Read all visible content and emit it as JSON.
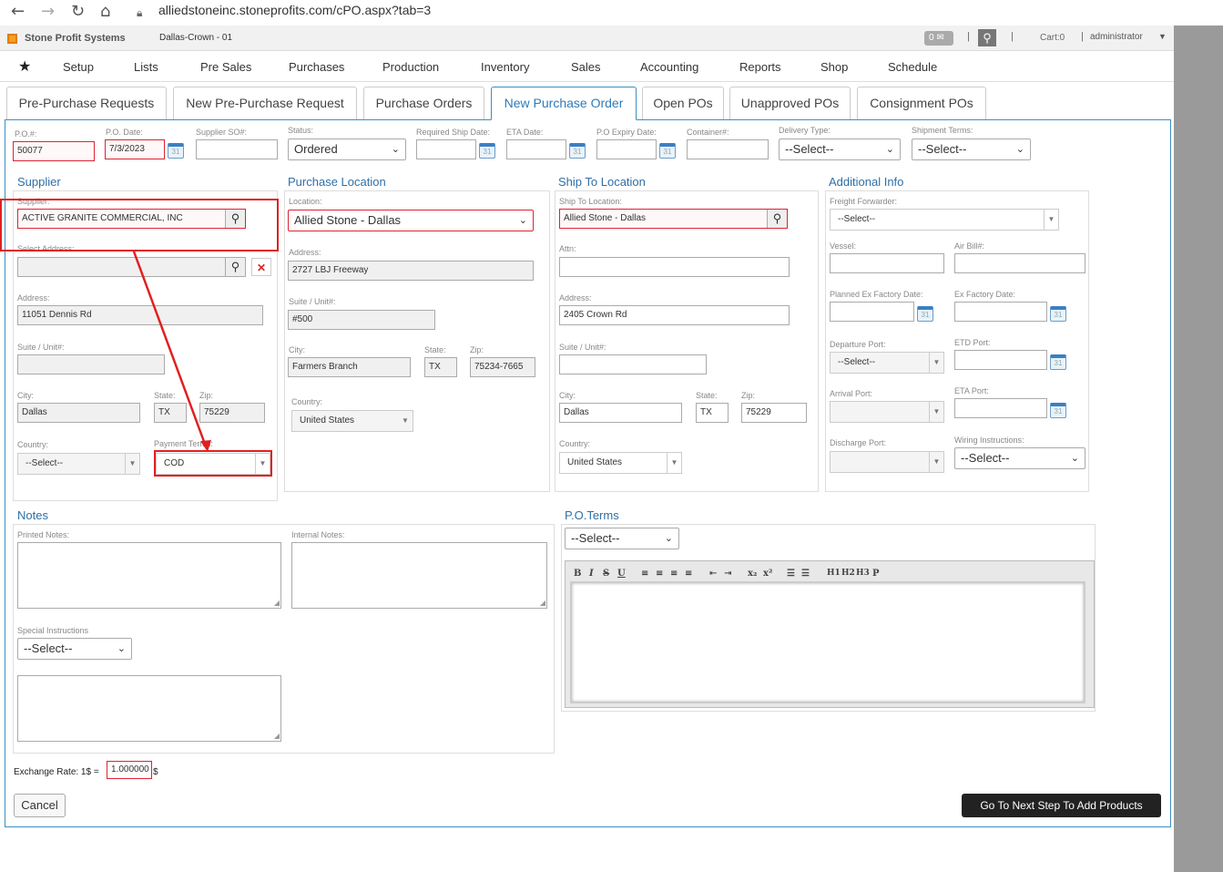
{
  "browser": {
    "url": "alliedstoneinc.stoneprofits.com/cPO.aspx?tab=3",
    "icons": [
      "back-icon",
      "forward-icon",
      "reload-icon",
      "home-icon",
      "lock-icon"
    ]
  },
  "appbar": {
    "brand": "Stone Profit Systems",
    "location": "Dallas-Crown - 01",
    "mail_count": "0",
    "cart": "Cart:0",
    "user": "administrator",
    "sep": "|"
  },
  "menu": {
    "star": "★",
    "items": [
      "Setup",
      "Lists",
      "Pre Sales",
      "Purchases",
      "Production",
      "Inventory",
      "Sales",
      "Accounting",
      "Reports",
      "Shop",
      "Schedule"
    ]
  },
  "tabs": [
    "Pre-Purchase Requests",
    "New Pre-Purchase Request",
    "Purchase Orders",
    "New Purchase Order",
    "Open POs",
    "Unapproved POs",
    "Consignment POs"
  ],
  "header": {
    "po_label": "P.O.#:",
    "po_value": "50077",
    "po_date_label": "P.O. Date:",
    "po_date_value": "7/3/2023",
    "supplier_so_label": "Supplier SO#:",
    "supplier_so_value": "",
    "status_label": "Status:",
    "status_value": "Ordered",
    "req_ship_label": "Required Ship Date:",
    "eta_label": "ETA Date:",
    "expiry_label": "P.O Expiry Date:",
    "container_label": "Container#:",
    "delivery_label": "Delivery Type:",
    "delivery_value": "--Select--",
    "shipment_label": "Shipment Terms:",
    "shipment_value": "--Select--",
    "cal_text": "31"
  },
  "supplier": {
    "title": "Supplier",
    "supplier_label": "Supplier:",
    "supplier_value": "ACTIVE GRANITE COMMERCIAL, INC",
    "select_address_label": "Select Address:",
    "select_address_value": "",
    "address_label": "Address:",
    "address_value": "11051 Dennis Rd",
    "suite_label": "Suite / Unit#:",
    "suite_value": "",
    "city_label": "City:",
    "city_value": "Dallas",
    "state_label": "State:",
    "state_value": "TX",
    "zip_label": "Zip:",
    "zip_value": "75229",
    "country_label": "Country:",
    "country_value": "--Select--",
    "payment_label": "Payment Terms:",
    "payment_value": "COD"
  },
  "purchase_location": {
    "title": "Purchase Location",
    "location_label": "Location:",
    "location_value": "Allied Stone - Dallas",
    "address_label": "Address:",
    "address_value": "2727 LBJ Freeway",
    "suite_label": "Suite / Unit#:",
    "suite_value": "#500",
    "city_label": "City:",
    "city_value": "Farmers Branch",
    "state_label": "State:",
    "state_value": "TX",
    "zip_label": "Zip:",
    "zip_value": "75234-7665",
    "country_label": "Country:",
    "country_value": "United States"
  },
  "ship_to": {
    "title": "Ship To Location",
    "location_label": "Ship To Location:",
    "location_value": "Allied Stone - Dallas",
    "attn_label": "Attn:",
    "attn_value": "",
    "address_label": "Address:",
    "address_value": "2405 Crown Rd",
    "suite_label": "Suite / Unit#:",
    "suite_value": "",
    "city_label": "City:",
    "city_value": "Dallas",
    "state_label": "State:",
    "state_value": "TX",
    "zip_label": "Zip:",
    "zip_value": "75229",
    "country_label": "Country:",
    "country_value": "United States"
  },
  "additional": {
    "title": "Additional Info",
    "freight_label": "Freight Forwarder:",
    "freight_value": "--Select--",
    "vessel_label": "Vessel:",
    "airbill_label": "Air Bill#:",
    "planned_label": "Planned Ex Factory Date:",
    "exfactory_label": "Ex Factory Date:",
    "departure_label": "Departure Port:",
    "departure_value": "--Select--",
    "etd_label": "ETD Port:",
    "arrival_label": "Arrival Port:",
    "eta_port_label": "ETA Port:",
    "discharge_label": "Discharge Port:",
    "wiring_label": "Wiring Instructions:",
    "wiring_value": "--Select--"
  },
  "notes": {
    "title": "Notes",
    "printed_label": "Printed Notes:",
    "internal_label": "Internal Notes:",
    "special_label": "Special Instructions",
    "special_value": "--Select--"
  },
  "terms": {
    "title": "P.O.Terms",
    "select_value": "--Select--",
    "toolbar": [
      "B",
      "I",
      "S",
      "U",
      "≡",
      "≡",
      "≡",
      "≡",
      "⇤",
      "⇥",
      "x₂",
      "x²",
      "☰",
      "☰",
      "H1",
      "H2",
      "H3",
      "P"
    ]
  },
  "footer": {
    "exchange_label": "Exchange Rate: 1$ =",
    "exchange_value": "1.000000",
    "exchange_suffix": "$",
    "cancel_label": "Cancel",
    "next_label": "Go To Next Step To Add Products"
  }
}
